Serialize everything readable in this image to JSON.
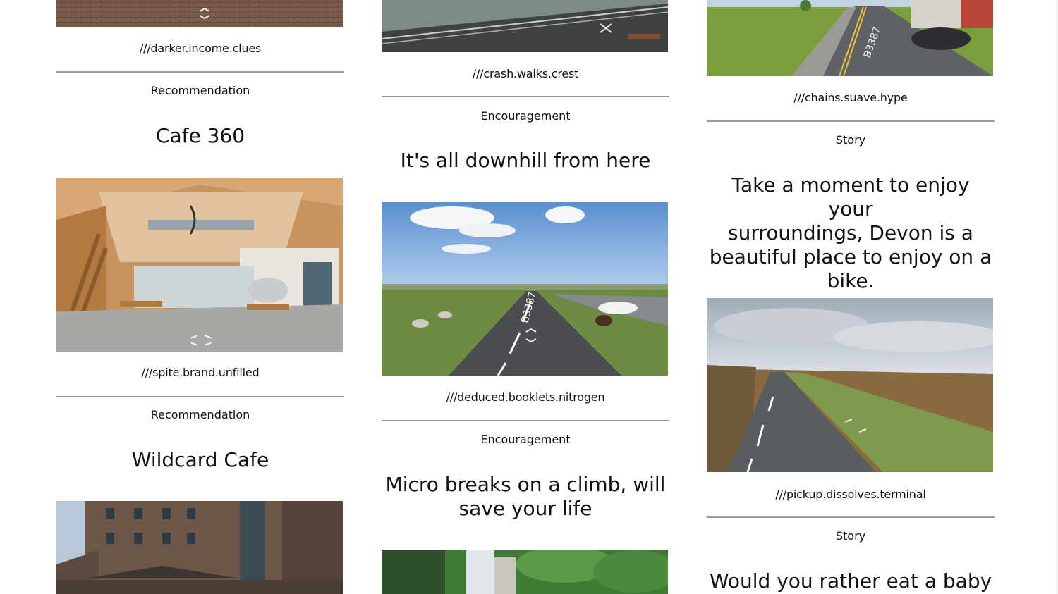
{
  "columns": [
    {
      "cards": [
        {
          "w3w": "///darker.income.clues"
        },
        {
          "tag": "Recommendation",
          "title": "Cafe 360",
          "w3w": "///spite.brand.unfilled"
        },
        {
          "tag": "Recommendation",
          "title": "Wildcard Cafe"
        }
      ]
    },
    {
      "cards": [
        {
          "w3w": "///crash.walks.crest"
        },
        {
          "tag": "Encouragement",
          "title": "It's all downhill from here",
          "w3w": "///deduced.booklets.nitrogen"
        },
        {
          "tag": "Encouragement",
          "title_line1": "Micro breaks on a climb, will",
          "title_line2": "save your life"
        }
      ]
    },
    {
      "cards": [
        {
          "w3w": "///chains.suave.hype",
          "road_marking": "B3387"
        },
        {
          "tag": "Story",
          "title_lines": [
            "Take a moment to enjoy your",
            "surroundings, Devon is a",
            "beautiful place to enjoy on a",
            "bike."
          ],
          "w3w": "///pickup.dissolves.terminal"
        },
        {
          "tag": "Story",
          "title": "Would you rather eat a baby"
        }
      ]
    }
  ],
  "road_marking_2": "B3387"
}
